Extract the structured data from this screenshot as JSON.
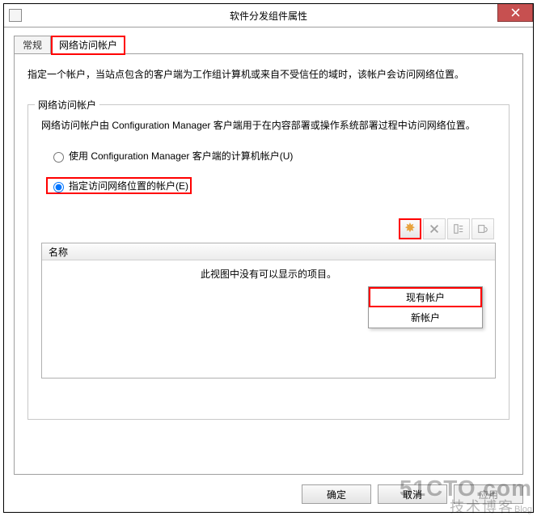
{
  "window": {
    "title": "软件分发组件属性"
  },
  "tabs": {
    "general": "常规",
    "network": "网络访问帐户"
  },
  "description": "指定一个帐户，当站点包含的客户端为工作组计算机或来自不受信任的域时，该帐户会访问网络位置。",
  "group": {
    "title": "网络访问帐户",
    "desc": "网络访问帐户由 Configuration Manager 客户端用于在内容部署或操作系统部署过程中访问网络位置。",
    "radio_computer": "使用 Configuration Manager 客户端的计算机帐户(U)",
    "radio_specify": "指定访问网络位置的帐户(E)"
  },
  "list": {
    "col_name": "名称",
    "empty": "此视图中没有可以显示的项目。"
  },
  "menu": {
    "existing": "现有帐户",
    "new": "新帐户"
  },
  "buttons": {
    "ok": "确定",
    "cancel": "取消",
    "apply": "应用"
  },
  "watermark": {
    "line1": "51CTO.com",
    "line2_cn": "技术博客",
    "line2_en": "Blog"
  }
}
